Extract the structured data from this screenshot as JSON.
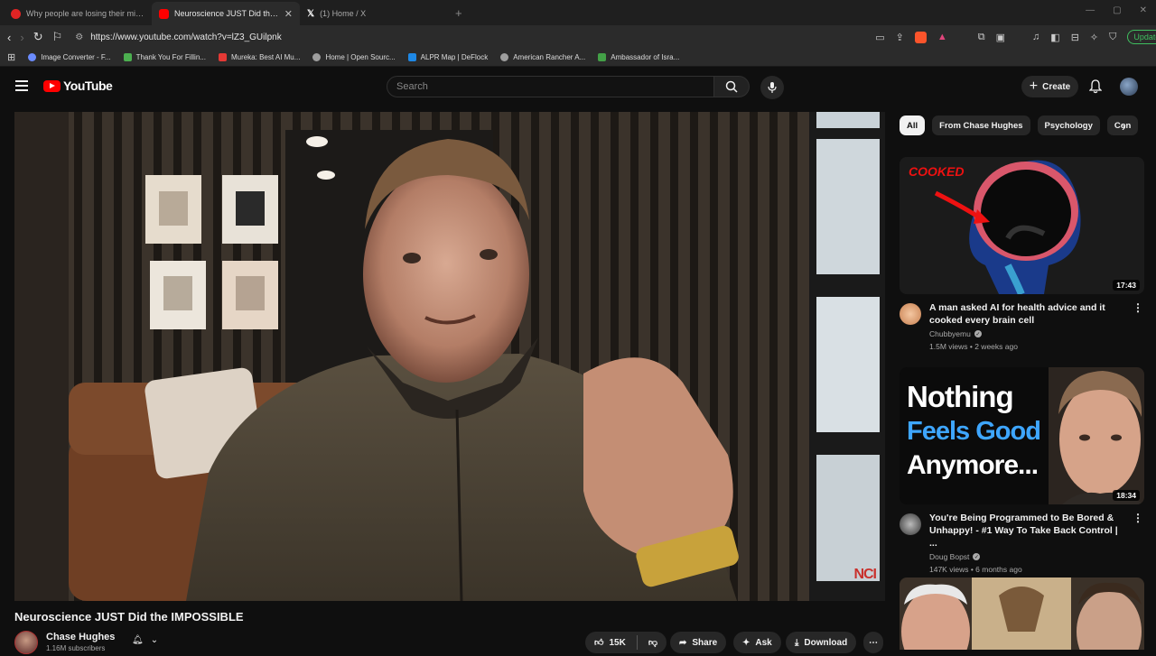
{
  "browser": {
    "tabs": [
      {
        "title": "Why people are losing their minds o",
        "active": false
      },
      {
        "title": "Neuroscience JUST Did the IMPO",
        "active": true
      },
      {
        "title": "(1) Home / X",
        "active": false
      }
    ],
    "url": "https://www.youtube.com/watch?v=lZ3_GUilpnk",
    "update_label": "Update",
    "bookmarks": [
      {
        "label": "Image Converter - F...",
        "color": "#6b8cff"
      },
      {
        "label": "Thank You For Fillin...",
        "color": "#4caf50"
      },
      {
        "label": "Mureka: Best AI Mu...",
        "color": "#e53935"
      },
      {
        "label": "Home | Open Sourc...",
        "color": "#9e9e9e"
      },
      {
        "label": "ALPR Map | DeFlock",
        "color": "#1e88e5"
      },
      {
        "label": "American Rancher A...",
        "color": "#9e9e9e"
      },
      {
        "label": "Ambassador of Isra...",
        "color": "#43a047"
      }
    ]
  },
  "youtube": {
    "logo_text": "YouTube",
    "search_placeholder": "Search",
    "create_label": "Create"
  },
  "video": {
    "title": "Neuroscience JUST Did the IMPOSSIBLE",
    "watermark": "NCI",
    "channel_name": "Chase Hughes",
    "subscribers": "1.16M subscribers",
    "likes": "15K",
    "share_label": "Share",
    "ask_label": "Ask",
    "download_label": "Download"
  },
  "sidebar": {
    "chips": [
      "All",
      "From Chase Hughes",
      "Psychology",
      "Con"
    ],
    "recommendations": [
      {
        "title": "A man asked AI for health advice and it cooked every brain cell",
        "channel": "Chubbyemu",
        "stats": "1.5M views • 2 weeks ago",
        "duration": "17:43",
        "thumb_text": "COOKED"
      },
      {
        "title": "You're Being Programmed to Be Bored & Unhappy! - #1 Way To Take Back Control | ...",
        "channel": "Doug Bopst",
        "stats": "147K views • 6 months ago",
        "duration": "18:34",
        "thumb_lines": [
          "Nothing",
          "Feels Good",
          "Anymore..."
        ]
      }
    ]
  },
  "colors": {
    "brand_red": "#ff0000",
    "background": "#0f0f0f",
    "chip_bg": "#272727",
    "accent_blue": "#3ea6ff"
  }
}
